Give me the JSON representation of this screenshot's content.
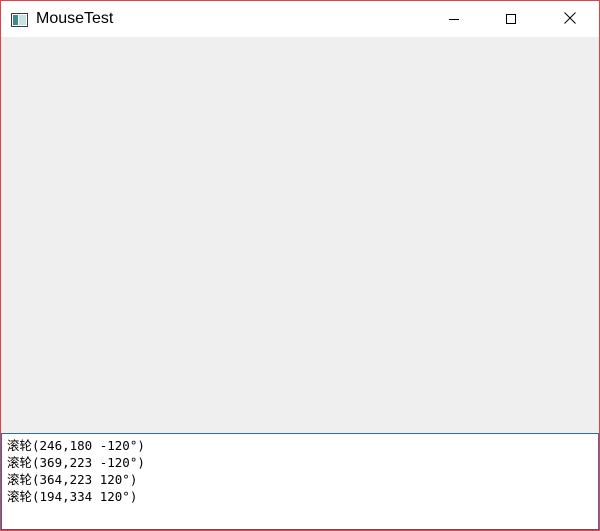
{
  "window": {
    "title": "MouseTest"
  },
  "icons": {
    "app": "app-window-icon",
    "minimize": "minimize-icon",
    "maximize": "maximize-icon",
    "close": "close-icon"
  },
  "log": {
    "lines": [
      "滚轮(246,180 -120°)",
      "滚轮(369,223 -120°)",
      "滚轮(364,223 120°)",
      "滚轮(194,334 120°)"
    ]
  }
}
